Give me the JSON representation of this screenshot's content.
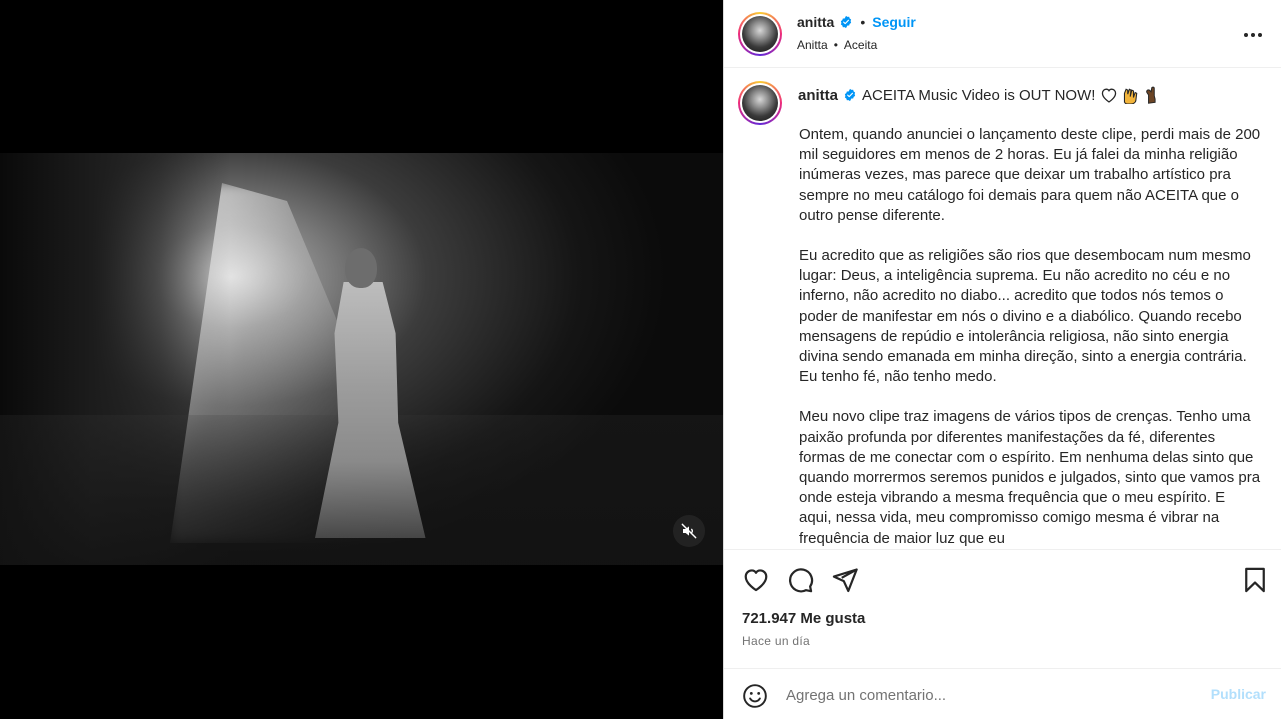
{
  "post": {
    "username": "anitta",
    "follow_label": "Seguir",
    "dot": "•",
    "subline": {
      "artist": "Anitta",
      "song": "Aceita"
    },
    "caption": {
      "title": "ACEITA Music Video is OUT NOW!",
      "emojis": [
        "white-heart",
        "raising-hands",
        "dark-skin-pinched-hand"
      ],
      "paragraphs": [
        "Ontem, quando anunciei o lançamento deste clipe, perdi mais de 200 mil seguidores em menos de 2 horas. Eu já falei da minha religião inúmeras vezes, mas parece que deixar um trabalho artístico pra sempre no meu catálogo foi demais para quem não ACEITA que o outro pense diferente.",
        "Eu acredito que as religiões são rios que desembocam num mesmo lugar: Deus, a inteligência suprema. Eu não acredito no céu e no inferno, não acredito no diabo... acredito que todos nós temos o poder de manifestar em nós o divino e a diabólico. Quando recebo mensagens de repúdio e intolerância religiosa, não sinto energia divina sendo emanada em minha direção, sinto a energia contrária. Eu tenho fé, não tenho medo.",
        "Meu novo clipe traz imagens de vários tipos de crenças. Tenho uma paixão profunda por diferentes manifestações da fé, diferentes formas de me conectar com o espírito. Em nenhuma delas sinto que quando morrermos seremos punidos e julgados, sinto que vamos pra onde esteja vibrando a mesma frequência que o meu espírito. E aqui, nessa vida, meu compromisso comigo mesma é vibrar na frequência de maior luz que eu"
      ]
    },
    "likes": "721.947 Me gusta",
    "time": "Hace un día",
    "comment_placeholder": "Agrega un comentario...",
    "publish_label": "Publicar"
  },
  "colors": {
    "link_blue": "#0095f6",
    "publish_disabled": "#b2dffc",
    "verified": "#0095f6",
    "text": "#262626",
    "muted": "#737373"
  },
  "icons": {
    "header_more": "more-horizontal-icon",
    "verified": "verified-badge-icon",
    "mute": "speaker-muted-icon",
    "like": "heart-icon",
    "comment": "comment-icon",
    "share": "send-icon",
    "save": "bookmark-icon",
    "emoji": "emoji-icon"
  }
}
